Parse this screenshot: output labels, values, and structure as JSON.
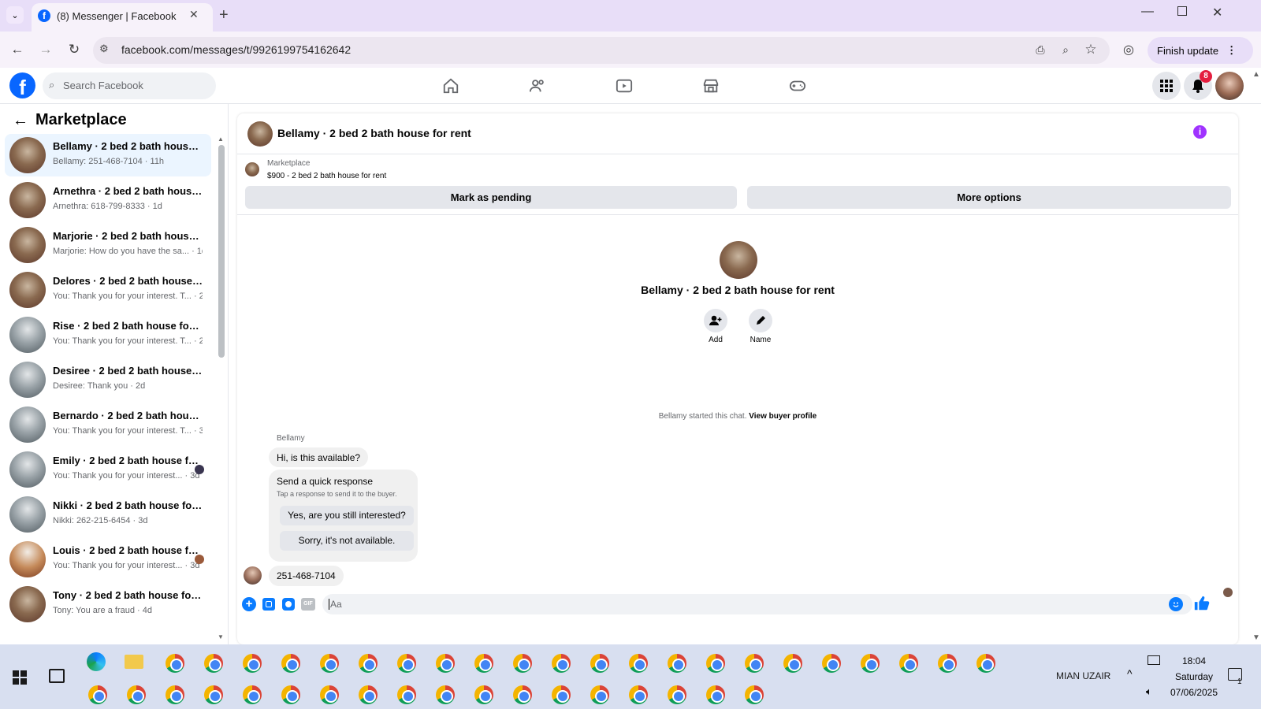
{
  "browser": {
    "tab_title": "(8) Messenger | Facebook",
    "url": "facebook.com/messages/t/9926199754162642",
    "finish_update": "Finish update"
  },
  "fb": {
    "search_placeholder": "Search Facebook",
    "notifications_count": "8"
  },
  "sidebar": {
    "title": "Marketplace",
    "conversations": [
      {
        "title": "Bellamy · 2 bed 2 bath house fo...",
        "snippet": "Bellamy: 251-468-7104 · 11h"
      },
      {
        "title": "Arnethra · 2 bed 2 bath house f...",
        "snippet": "Arnethra: 618-799-8333 · 1d"
      },
      {
        "title": "Marjorie · 2 bed 2 bath house f...",
        "snippet": "Marjorie: How do you have the sa...  ·  1d"
      },
      {
        "title": "Delores · 2 bed 2 bath house fo...",
        "snippet": "You: Thank you for your interest. T...  ·  2d"
      },
      {
        "title": "Rise · 2 bed 2 bath house for rent",
        "snippet": "You: Thank you for your interest. T...  ·  2d"
      },
      {
        "title": "Desiree · 2 bed 2 bath house for...",
        "snippet": "Desiree: Thank you · 2d"
      },
      {
        "title": "Bernardo · 2 bed 2 bath house f...",
        "snippet": "You: Thank you for your interest. T...  ·  3d"
      },
      {
        "title": "Emily · 2 bed 2 bath house fo...",
        "snippet": "You: Thank you for your interest...  ·  3d"
      },
      {
        "title": "Nikki · 2 bed 2 bath house for r...",
        "snippet": "Nikki: 262-215-6454 · 3d"
      },
      {
        "title": "Louis · 2 bed 2 bath house fo...",
        "snippet": "You: Thank you for your interest...  ·  3d"
      },
      {
        "title": "Tony · 2 bed 2 bath house for re...",
        "snippet": "Tony: You are a fraud · 4d"
      }
    ]
  },
  "chat": {
    "header_title": "Bellamy · 2 bed 2 bath house for rent",
    "listing_source": "Marketplace",
    "listing_text": "$900 - 2 bed 2 bath house for rent",
    "mark_pending": "Mark as pending",
    "more_options": "More options",
    "profile_name": "Bellamy · 2 bed 2 bath house for rent",
    "add_label": "Add",
    "name_label": "Name",
    "started_text": "Bellamy started this chat.",
    "view_profile": "View buyer profile",
    "sender": "Bellamy",
    "message_1": "Hi, is this available?",
    "quick_title": "Send a quick response",
    "quick_subtitle": "Tap a response to send it to the buyer.",
    "quick_reply_1": "Yes, are you still interested?",
    "quick_reply_2": "Sorry, it's not available.",
    "message_2": "251-468-7104",
    "input_placeholder": "Aa",
    "gif_label": "GIF"
  },
  "taskbar": {
    "user": "MIAN UZAIR",
    "time": "18:04",
    "day": "Saturday",
    "date": "07/06/2025",
    "notif_count": "1"
  },
  "colors": {
    "fb_blue": "#0866ff",
    "messenger_blue": "#0a7cff",
    "info_purple": "#a033ff"
  }
}
